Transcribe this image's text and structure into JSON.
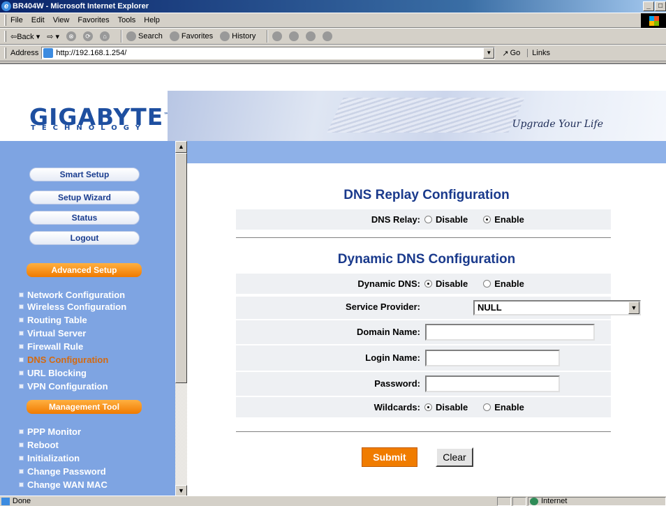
{
  "window": {
    "title": "BR404W - Microsoft Internet Explorer",
    "min": "_",
    "max": "□"
  },
  "menu": [
    "File",
    "Edit",
    "View",
    "Favorites",
    "Tools",
    "Help"
  ],
  "toolbar": {
    "back": "⇦Back ▾",
    "forward": "⇨ ▾",
    "stop": "⊗",
    "refresh": "⟳",
    "home": "⌂",
    "search": "Search",
    "favorites": "Favorites",
    "history": "History"
  },
  "address": {
    "label": "Address",
    "url": "http://192.168.1.254/",
    "go": "Go",
    "links": "Links"
  },
  "brand": {
    "logo": "GIGABYTE",
    "logo_tm": "™",
    "logo_sub": "TECHNOLOGY",
    "tagline": "Upgrade Your Life"
  },
  "sidebar": {
    "buttons": [
      "Smart Setup",
      "Setup Wizard",
      "Status",
      "Logout"
    ],
    "advanced_header": "Advanced Setup",
    "advanced_items": [
      "Network Configuration",
      "Wireless Configuration",
      "Routing Table",
      "Virtual Server",
      "Firewall Rule",
      "DNS Configuration",
      "URL Blocking",
      "VPN Configuration"
    ],
    "active_item": "DNS Configuration",
    "management_header": "Management Tool",
    "management_items": [
      "PPP Monitor",
      "Reboot",
      "Initialization",
      "Change Password",
      "Change WAN MAC"
    ]
  },
  "dns_relay": {
    "heading": "DNS Replay Configuration",
    "label": "DNS Relay:",
    "options": [
      "Disable",
      "Enable"
    ],
    "selected": "Enable"
  },
  "ddns": {
    "heading": "Dynamic DNS Configuration",
    "dynamic_label": "Dynamic DNS:",
    "dynamic_options": [
      "Disable",
      "Enable"
    ],
    "dynamic_selected": "Disable",
    "provider_label": "Service Provider:",
    "provider_value": "NULL",
    "domain_label": "Domain Name:",
    "domain_value": "",
    "login_label": "Login Name:",
    "login_value": "",
    "password_label": "Password:",
    "password_value": "",
    "wildcards_label": "Wildcards:",
    "wildcards_options": [
      "Disable",
      "Enable"
    ],
    "wildcards_selected": "Disable"
  },
  "actions": {
    "submit": "Submit",
    "clear": "Clear"
  },
  "status": {
    "text": "Done",
    "zone": "Internet"
  },
  "colors": {
    "title_bar": "#0a246a",
    "sidebar": "#7ea4e2",
    "heading": "#1a3a8c",
    "accent": "#f07c00",
    "active_nav": "#d46a10"
  }
}
